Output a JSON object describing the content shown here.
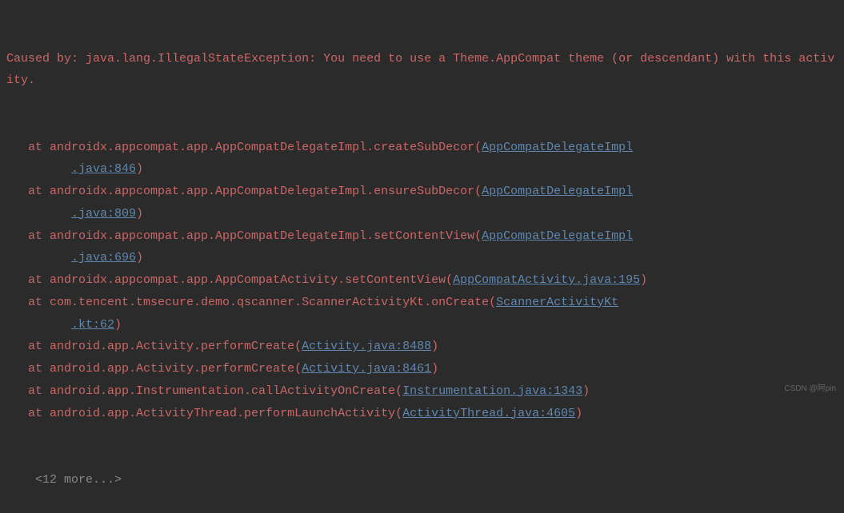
{
  "exception": {
    "prefix": "Caused by: ",
    "type": "java.lang.IllegalStateException",
    "message": "You need to use a Theme.AppCompat theme (or descendant) with this activity."
  },
  "frames": [
    {
      "method": "androidx.appcompat.app.AppCompatDelegateImpl.createSubDecor",
      "source": "AppCompatDelegateImpl.java:846",
      "wrap": true
    },
    {
      "method": "androidx.appcompat.app.AppCompatDelegateImpl.ensureSubDecor",
      "source": "AppCompatDelegateImpl.java:809",
      "wrap": true
    },
    {
      "method": "androidx.appcompat.app.AppCompatDelegateImpl.setContentView",
      "source": "AppCompatDelegateImpl.java:696",
      "wrap": true
    },
    {
      "method": "androidx.appcompat.app.AppCompatActivity.setContentView",
      "source": "AppCompatActivity.java:195",
      "wrap": false
    },
    {
      "method": "com.tencent.tmsecure.demo.qscanner.ScannerActivityKt.onCreate",
      "source": "ScannerActivityKt.kt:62",
      "wrap": true
    },
    {
      "method": "android.app.Activity.performCreate",
      "source": "Activity.java:8488",
      "wrap": false
    },
    {
      "method": "android.app.Activity.performCreate",
      "source": "Activity.java:8461",
      "wrap": false
    },
    {
      "method": "android.app.Instrumentation.callActivityOnCreate",
      "source": "Instrumentation.java:1343",
      "wrap": false
    },
    {
      "method": "android.app.ActivityThread.performLaunchActivity",
      "source": "ActivityThread.java:4605",
      "wrap": false
    }
  ],
  "more": "<12 more...>",
  "watermark": "CSDN @阿pin"
}
